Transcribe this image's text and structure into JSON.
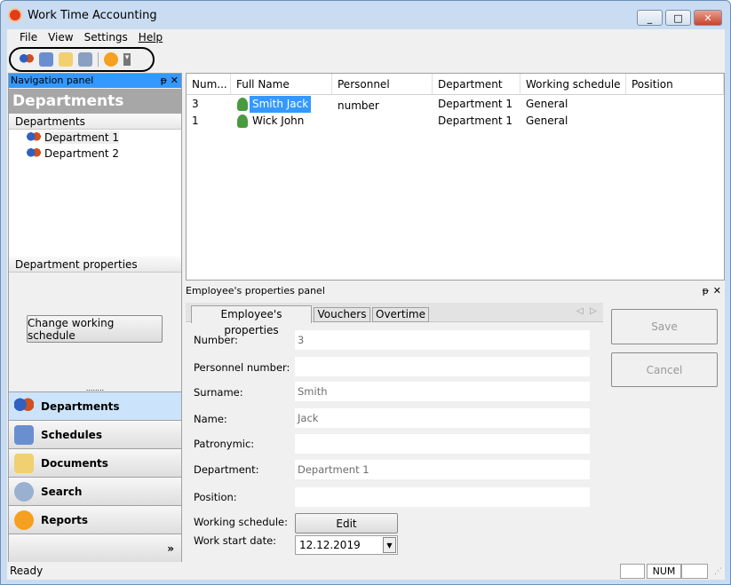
{
  "window": {
    "title": "Work Time Accounting",
    "minimize": "_",
    "maximize": "□",
    "close": "✕"
  },
  "menu": [
    "File",
    "View",
    "Settings",
    "Help"
  ],
  "toolbar": {
    "icons": [
      "departments-icon",
      "schedules-icon",
      "documents-icon",
      "search-icon",
      "reports-icon"
    ],
    "overflow": "▾"
  },
  "nav": {
    "header": "Navigation panel",
    "pin": "ᵽ",
    "close": "✕",
    "title": "Departments",
    "tree_header": "Departments",
    "tree": [
      "Department 1",
      "Department 2"
    ],
    "props_header": "Department properties",
    "change_button": "Change working schedule",
    "grip": "........",
    "buttons": [
      "Departments",
      "Schedules",
      "Documents",
      "Search",
      "Reports"
    ],
    "more": "»"
  },
  "grid": {
    "columns": [
      "Num...",
      "Full Name",
      "Personnel number",
      "Department",
      "Working schedule",
      "Position"
    ],
    "rows": [
      [
        "3",
        "Smith Jack",
        "",
        "Department 1",
        "General",
        ""
      ],
      [
        "1",
        "Wick John",
        "",
        "Department 1",
        "General",
        ""
      ]
    ]
  },
  "props": {
    "header": "Employee's properties panel",
    "pin": "ᵽ",
    "close": "✕",
    "tabs": [
      "Employee's properties",
      "Vouchers",
      "Overtime"
    ],
    "fields": [
      {
        "label": "Number:",
        "value": "3"
      },
      {
        "label": "Personnel number:",
        "value": ""
      },
      {
        "label": "Surname:",
        "value": "Smith"
      },
      {
        "label": "Name:",
        "value": "Jack"
      },
      {
        "label": "Patronymic:",
        "value": ""
      },
      {
        "label": "Department:",
        "value": "Department 1"
      },
      {
        "label": "Position:",
        "value": ""
      }
    ],
    "schedule_label": "Working schedule:",
    "edit_button": "Edit",
    "start_label": "Work start date:",
    "start_value": "12.12.2019",
    "save": "Save",
    "cancel": "Cancel"
  },
  "status": {
    "text": "Ready",
    "num": "NUM"
  },
  "colors": {
    "nav_header": "#3399ff",
    "selection": "#3399ff",
    "active_nav": "#cce4fb"
  }
}
